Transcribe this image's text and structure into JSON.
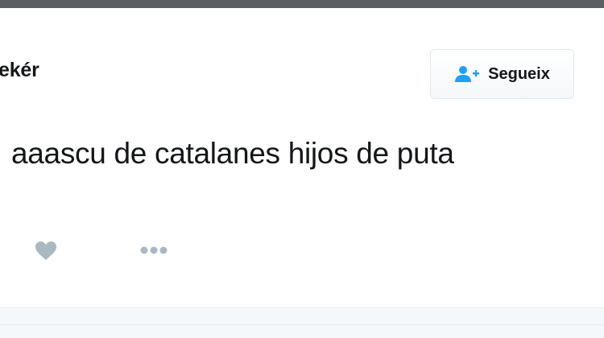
{
  "tweet": {
    "author_name": "ekér",
    "text": "aaascu de catalanes hijos de puta"
  },
  "follow_button": {
    "label": "Segueix",
    "icon": "add-user-icon"
  },
  "actions": {
    "like_icon": "heart-icon",
    "more_icon": "more-dots-icon"
  },
  "colors": {
    "accent": "#1da1f2",
    "text": "#14171a",
    "icon_muted": "#aab8c2",
    "border": "#e1e8ed"
  }
}
